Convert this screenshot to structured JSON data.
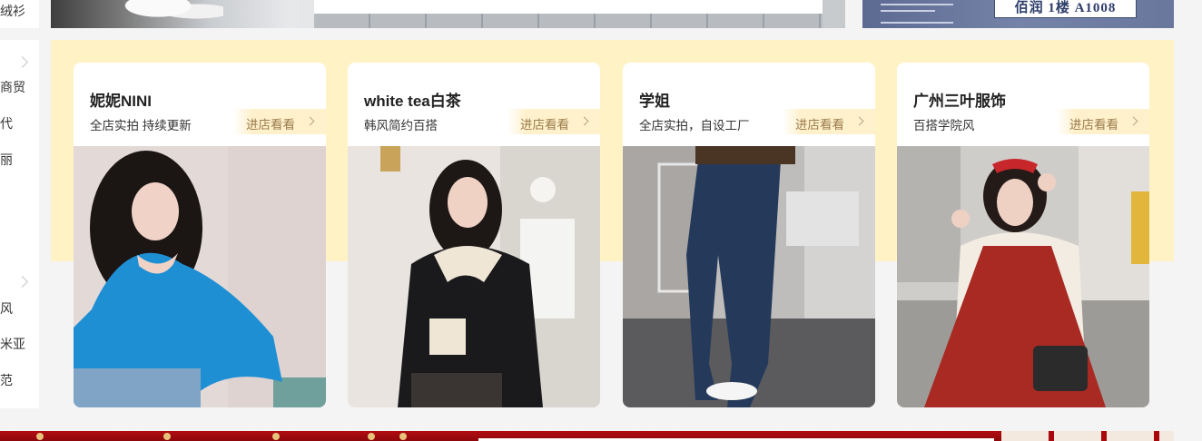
{
  "sidebar": {
    "top_item": "绒衫",
    "items": [
      "商贸",
      "代",
      "丽",
      "风",
      "米亚",
      "范"
    ]
  },
  "banner_top_right": {
    "address": "佰润 1楼 A1008"
  },
  "stores": [
    {
      "name": "妮妮NINI",
      "desc": "全店实拍 持续更新",
      "enter": "进店看看"
    },
    {
      "name": "white tea白茶",
      "desc": "韩风简约百搭",
      "enter": "进店看看"
    },
    {
      "name": "学姐",
      "desc": "全店实拍，自设工厂",
      "enter": "进店看看"
    },
    {
      "name": "广州三叶服饰",
      "desc": "百搭学院风",
      "enter": "进店看看"
    }
  ],
  "colors": {
    "section_bg": "#fff3c5",
    "enter_text": "#9b7b4b",
    "bottom_banner": "#b10d12"
  }
}
